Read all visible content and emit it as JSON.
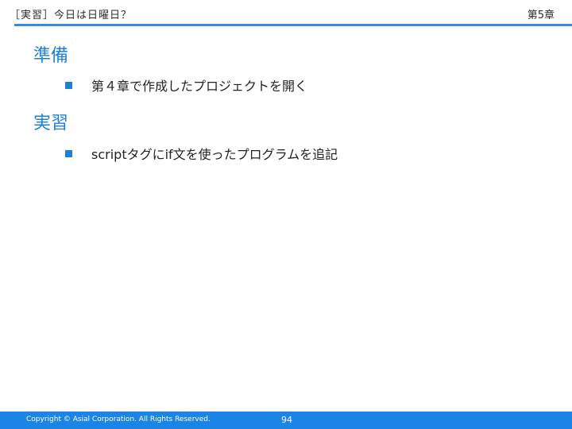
{
  "header": {
    "title": "［実習］今日は日曜日？",
    "chapter": "第5章"
  },
  "sections": [
    {
      "heading": "準備",
      "bullets": [
        "第４章で作成したプロジェクトを開く"
      ]
    },
    {
      "heading": "実習",
      "bullets": [
        "scriptタグにif文を使ったプログラムを追記"
      ]
    }
  ],
  "footer": {
    "copyright": "Copyright © Asial Corporation. All Rights Reserved.",
    "page_number": "94"
  },
  "colors": {
    "accent": "#1e7fd6",
    "footer_bar": "#1a85e6",
    "header_rule": "#2f8fe0"
  }
}
